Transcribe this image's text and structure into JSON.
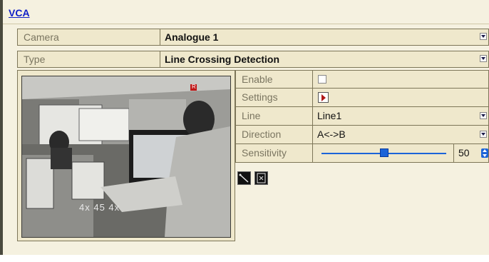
{
  "header": {
    "title": "VCA"
  },
  "form": {
    "camera": {
      "label": "Camera",
      "value": "Analogue 1"
    },
    "type": {
      "label": "Type",
      "value": "Line Crossing Detection"
    }
  },
  "preview": {
    "overlay_text": "4x  45  4x",
    "indicator": "R"
  },
  "settings": {
    "enable": {
      "label": "Enable",
      "checked": false
    },
    "settings": {
      "label": "Settings"
    },
    "line": {
      "label": "Line",
      "value": "Line1"
    },
    "direction": {
      "label": "Direction",
      "value": "A<->B"
    },
    "sensitivity": {
      "label": "Sensitivity",
      "value": "50",
      "fraction": 0.5
    }
  },
  "tools": [
    {
      "name": "draw-line-icon"
    },
    {
      "name": "clear-icon"
    }
  ],
  "colors": {
    "accent": "#1c64d8",
    "settings_arrow": "#b01818",
    "panel_bg": "#efe8cc",
    "page_bg": "#f5f1e0"
  }
}
